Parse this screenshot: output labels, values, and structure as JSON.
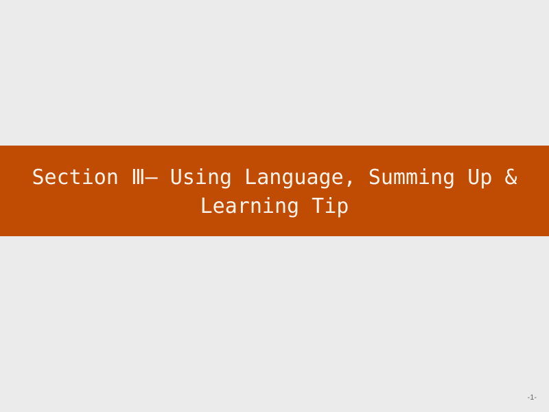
{
  "slide": {
    "title": "Section Ⅲ— Using Language, Summing Up & Learning Tip",
    "page_number": "-1-"
  },
  "colors": {
    "background": "#ebebeb",
    "title_band": "#c04c04",
    "title_text": "#fdf3ea",
    "page_number": "#666666"
  }
}
